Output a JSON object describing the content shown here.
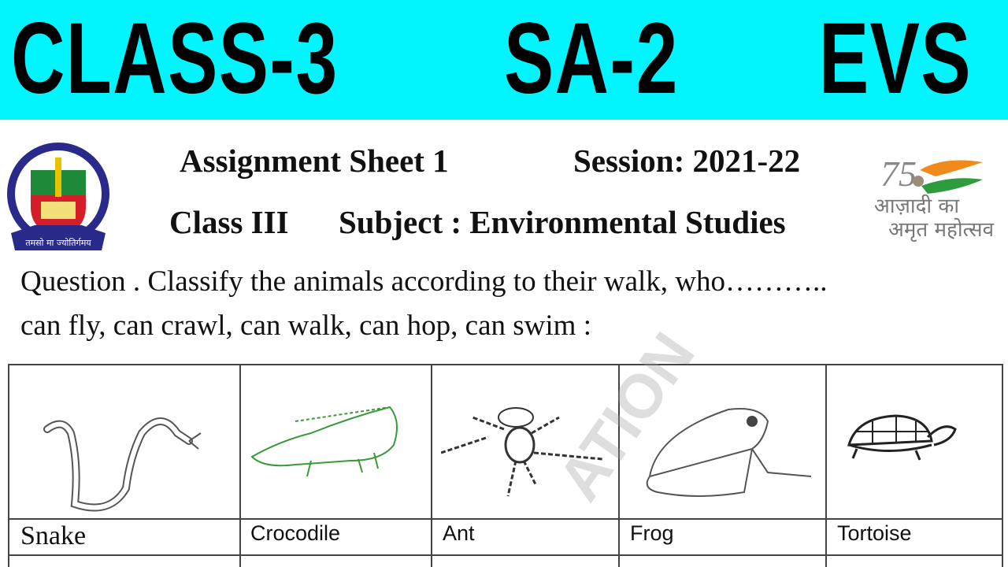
{
  "banner": {
    "part1": "CLASS-3",
    "part2": "SA-2",
    "part3": "EVS",
    "background_color": "#00f5ff"
  },
  "header": {
    "assignment": "Assignment Sheet 1",
    "session": "Session: 2021-22",
    "class": "Class III",
    "subject": "Subject : Environmental Studies"
  },
  "logos": {
    "left": {
      "icon": "municipal-corporation-emblem-icon",
      "motto": "तमसो मा ज्योतिर्गमय"
    },
    "right": {
      "icon": "azadi-ka-amrit-mahotsav-logo-icon",
      "line1": "आज़ादी का",
      "line2": "अमृत महोत्सव",
      "number": "75"
    }
  },
  "question": {
    "line1": "Question . Classify the animals according to their walk, who………..",
    "line2": "can fly, can crawl, can walk, can hop, can swim :"
  },
  "animals": [
    {
      "name": "Snake",
      "icon": "snake-drawing"
    },
    {
      "name": "Crocodile",
      "icon": "crocodile-drawing"
    },
    {
      "name": "Ant",
      "icon": "ant-drawing"
    },
    {
      "name": "Frog",
      "icon": "frog-drawing"
    },
    {
      "name": "Tortoise",
      "icon": "tortoise-drawing"
    }
  ],
  "watermark": "ATION"
}
